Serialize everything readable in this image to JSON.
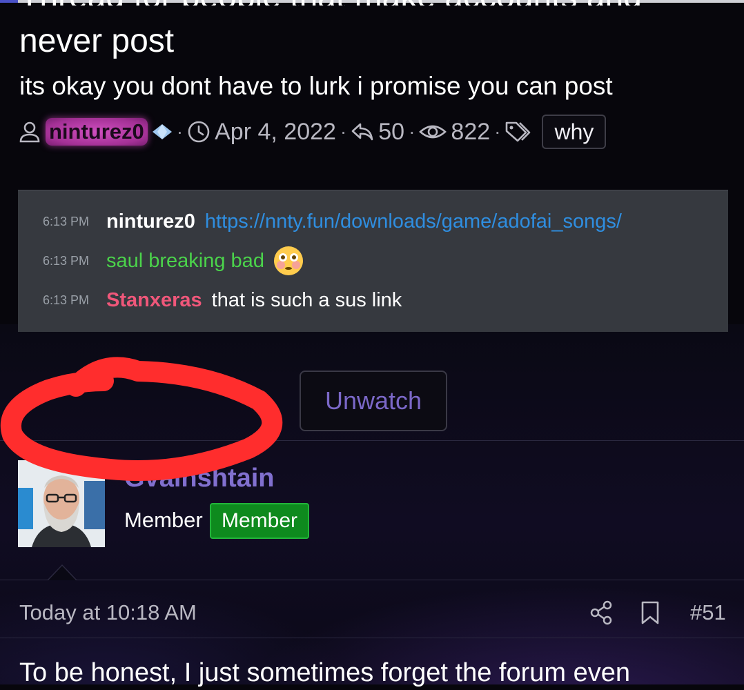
{
  "thread": {
    "title_top_partial": "Thread for people that make accounts and",
    "title": "never post",
    "description": "its okay you dont have to lurk i promise you can post",
    "author": "ninturez0",
    "date": "Apr 4, 2022",
    "replies": "50",
    "views": "822",
    "tag": "why"
  },
  "embed": {
    "messages": [
      {
        "time": "6:13 PM",
        "author": "ninturez0",
        "text": "https://nnty.fun/downloads/game/adofai_songs/"
      },
      {
        "time": "6:13 PM",
        "author": "",
        "text": "saul breaking bad"
      },
      {
        "time": "6:13 PM",
        "author": "Stanxeras",
        "text": "that is such a sus link"
      }
    ]
  },
  "actions": {
    "unwatch_label": "Unwatch"
  },
  "post": {
    "username": "Gvainshtain",
    "user_title": "Member",
    "banner": "Member",
    "date": "Today at 10:18 AM",
    "number": "#51",
    "body": "To be honest, I just sometimes forget the forum even"
  },
  "icons": {
    "author": "user-icon",
    "date": "clock-icon",
    "replies": "reply-icon",
    "views": "eye-icon",
    "tags": "tag-icon",
    "share": "share-icon",
    "bookmark": "bookmark-icon"
  },
  "colors": {
    "background": "#07060c",
    "accent": "#7b68c8",
    "username_badge": "#c040b0",
    "member_banner": "#0e8a1e",
    "embed_bg": "#36393f",
    "link": "#2f8ee0",
    "annotation_circle": "#ff2d2d"
  }
}
